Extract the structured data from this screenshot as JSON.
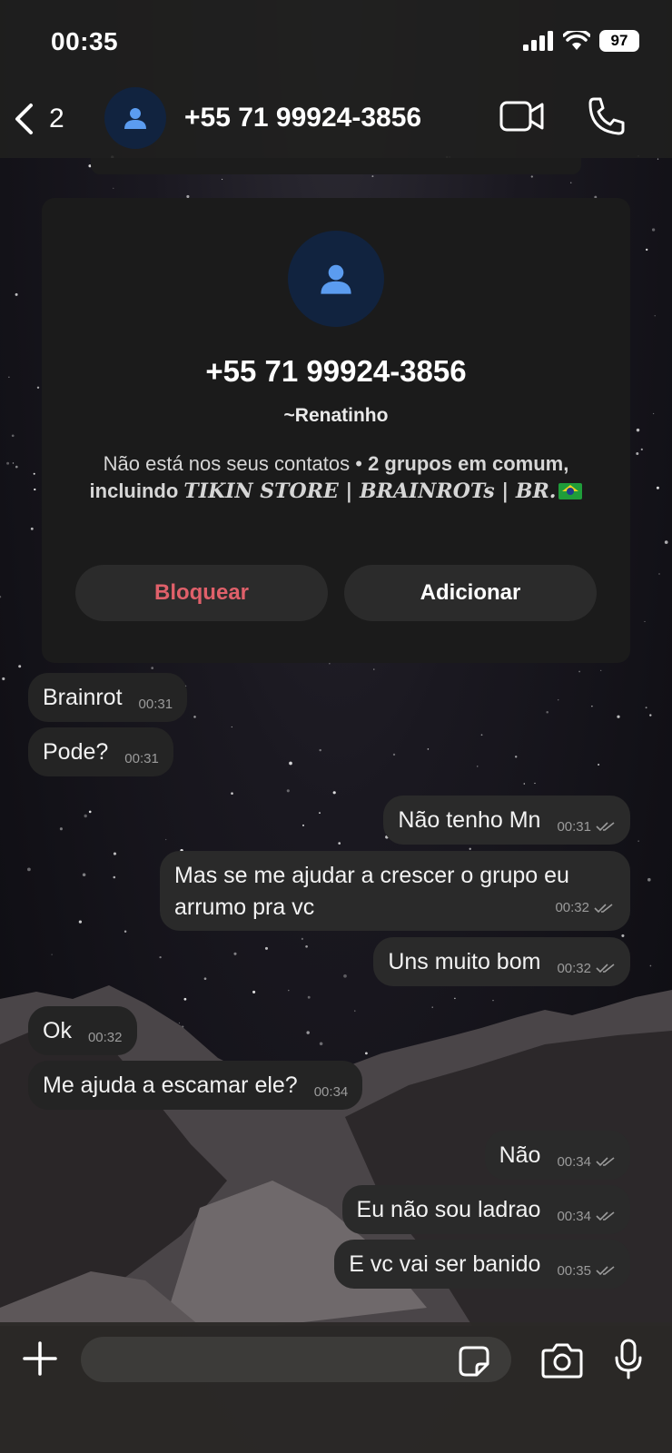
{
  "status_bar": {
    "time": "00:35",
    "battery": "97"
  },
  "header": {
    "back_count": "2",
    "title": "+55 71 99924-3856"
  },
  "contact_card": {
    "phone": "+55 71 99924-3856",
    "name": "~Renatinho",
    "info_prefix": "Não está nos seus contatos • ",
    "info_groups": "2 grupos em comum,",
    "info_including": "incluindo ",
    "info_group_name": "TIKIN  STORE | BRAINROTs | BR.",
    "block_label": "Bloquear",
    "add_label": "Adicionar"
  },
  "messages": [
    {
      "direction": "in",
      "text": "Brainrot",
      "time": "00:31"
    },
    {
      "direction": "in",
      "text": "Pode?",
      "time": "00:31"
    },
    {
      "direction": "out",
      "text": "Não tenho Mn",
      "time": "00:31"
    },
    {
      "direction": "out",
      "text": "Mas se me ajudar a crescer o grupo eu",
      "text2": "arrumo pra vc",
      "time": "00:32"
    },
    {
      "direction": "out",
      "text": "Uns muito bom",
      "time": "00:32"
    },
    {
      "direction": "in",
      "text": "Ok",
      "time": "00:32"
    },
    {
      "direction": "in",
      "text": "Me ajuda a escamar ele?",
      "time": "00:34"
    },
    {
      "direction": "out",
      "text": "Não",
      "time": "00:34"
    },
    {
      "direction": "out",
      "text": "Eu não sou ladrao",
      "time": "00:34"
    },
    {
      "direction": "out",
      "text": "E vc vai ser banido",
      "time": "00:35"
    }
  ],
  "composer": {
    "placeholder": ""
  },
  "icons": {
    "back": "chevron-left-icon",
    "video": "video-camera-icon",
    "call": "phone-icon",
    "plus": "plus-icon",
    "sticker": "sticker-icon",
    "camera": "camera-icon",
    "mic": "microphone-icon",
    "read": "double-check-icon"
  },
  "colors": {
    "block": "#e0606a",
    "avatar_bg": "#11233f",
    "avatar_fg": "#5b9cf0",
    "bubble": "#242424"
  }
}
